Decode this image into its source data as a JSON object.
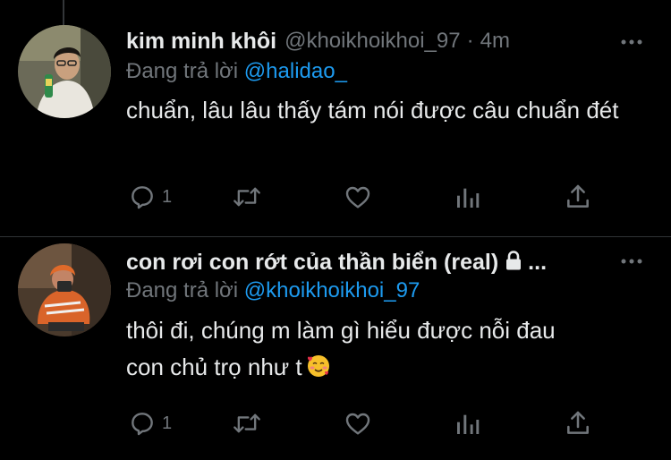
{
  "replies": [
    {
      "author_name": "kim minh khôi",
      "author_handle": "@khoikhoikhoi_97",
      "separator": "·",
      "timestamp": "4m",
      "replying_label": "Đang trả lời",
      "replying_to": "@halidao_",
      "text": "chuẩn, lâu lâu thấy tám nói được câu chuẩn đét",
      "reply_count": "1"
    },
    {
      "author_name": "con rơi con rớt của thần biển (real)",
      "name_truncation": "...",
      "author_handle": "",
      "replying_label": "Đang trả lời",
      "replying_to": "@khoikhoikhoi_97",
      "text_line1": "thôi đi, chúng m làm gì hiểu được nỗi đau",
      "text_line2": "con chủ trọ như t",
      "emoji": "smiling-face-with-hearts",
      "reply_count": "1"
    }
  ],
  "colors": {
    "background": "#000000",
    "text": "#e7e9ea",
    "muted": "#71767b",
    "accent": "#1d9bf0"
  },
  "icons": [
    "more-icon",
    "reply-icon",
    "retweet-icon",
    "like-icon",
    "views-icon",
    "share-icon",
    "lock-icon"
  ]
}
